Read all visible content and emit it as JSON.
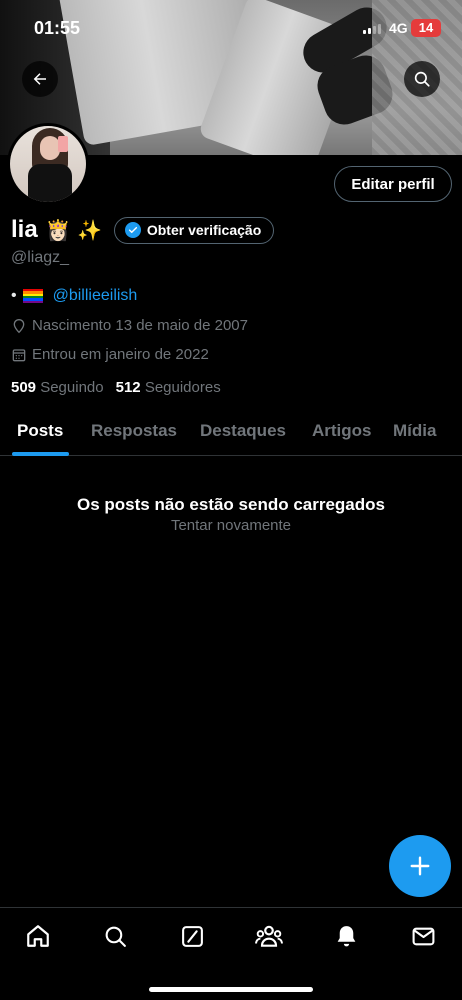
{
  "status_bar": {
    "time": "01:55",
    "network": "4G",
    "battery": "14"
  },
  "profile": {
    "name": "lia",
    "name_emoji": "👸🏻 ✨",
    "verify_label": "Obter verificação",
    "edit_label": "Editar perfil",
    "handle": "@liagz_",
    "bio_prefix": "•",
    "bio_mention": "@billieeilish",
    "birth": "Nascimento 13 de maio de 2007",
    "joined": "Entrou em janeiro de 2022",
    "following_count": "509",
    "following_label": "Seguindo",
    "followers_count": "512",
    "followers_label": "Seguidores"
  },
  "tabs": [
    {
      "label": "Posts",
      "active": true
    },
    {
      "label": "Respostas",
      "active": false
    },
    {
      "label": "Destaques",
      "active": false
    },
    {
      "label": "Artigos",
      "active": false
    },
    {
      "label": "Mídia",
      "active": false
    }
  ],
  "feed": {
    "error_title": "Os posts não estão sendo carregados",
    "retry_label": "Tentar novamente"
  },
  "icons": {
    "back": "arrow-left-icon",
    "search": "search-icon",
    "compose": "plus-icon",
    "nav": [
      "home-icon",
      "search-icon",
      "grok-icon",
      "communities-icon",
      "notifications-icon",
      "messages-icon"
    ]
  },
  "colors": {
    "accent": "#1d9bf0",
    "muted": "#71767b",
    "border": "#2f3336",
    "battery": "#e53b3b"
  }
}
